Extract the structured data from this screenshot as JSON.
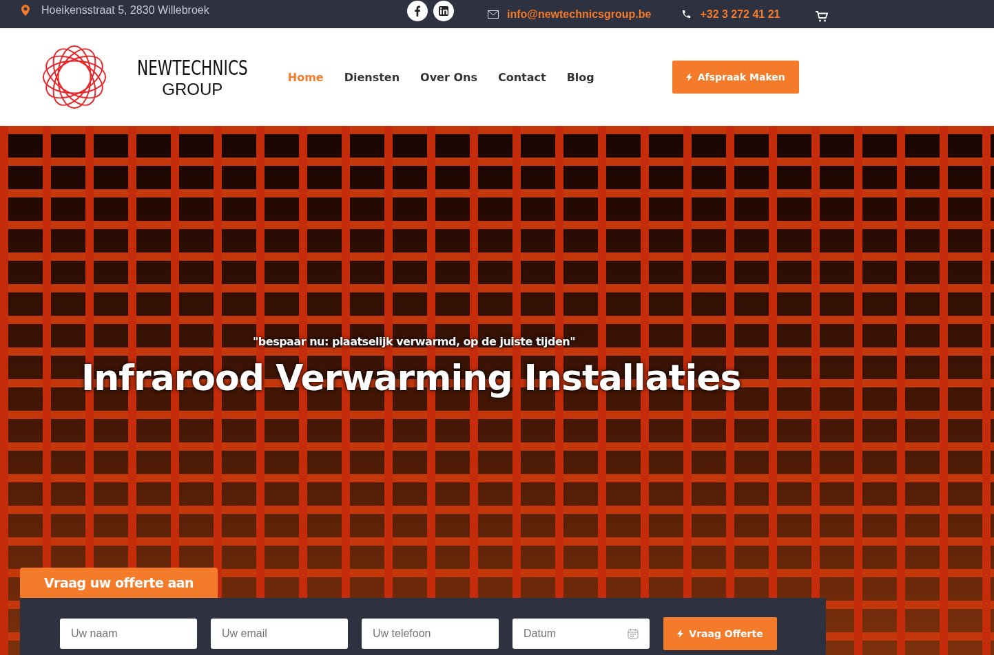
{
  "topbar": {
    "address": "Hoeikensstraat 5, 2830 Willebroek",
    "email": "info@newtechnicsgroup.be",
    "phone": "+32 3 272 41 21"
  },
  "header": {
    "logo": {
      "name": "NEWTECHNICS",
      "subtitle": "GROUP"
    },
    "nav": [
      {
        "label": "Home",
        "selected": true
      },
      {
        "label": "Diensten",
        "selected": false
      },
      {
        "label": "Over Ons",
        "selected": false
      },
      {
        "label": "Contact",
        "selected": false
      },
      {
        "label": "Blog",
        "selected": false
      }
    ],
    "cta": "Afspraak Maken"
  },
  "hero": {
    "tagline": "\"bespaar nu: plaatselijk verwarmd, op de juiste tijden\"",
    "title": "Infrarood Verwarming Installaties"
  },
  "quote_form": {
    "title": "Vraag uw offerte aan",
    "fields": [
      {
        "kind": "text",
        "placeholder": "Uw naam"
      },
      {
        "kind": "text",
        "placeholder": "Uw email"
      },
      {
        "kind": "text",
        "placeholder": "Uw telefoon"
      },
      {
        "kind": "date",
        "placeholder": "Datum"
      }
    ],
    "submit": "Vraag Offerte"
  }
}
